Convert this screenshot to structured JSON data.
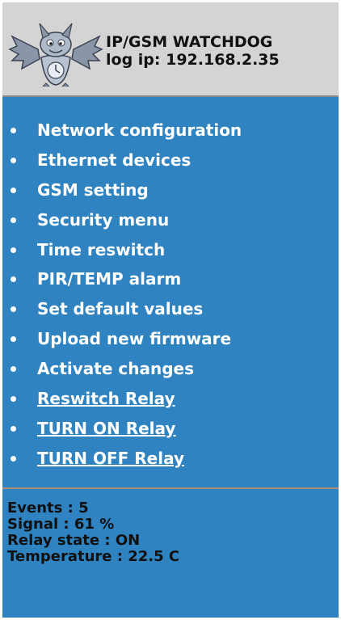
{
  "header": {
    "title": "IP/GSM WATCHDOG",
    "log_ip": "log ip: 192.168.2.35",
    "logo_icon": "bat-dragon-logo-icon"
  },
  "menu": {
    "items": [
      {
        "label": "Network configuration",
        "link": false
      },
      {
        "label": "Ethernet devices",
        "link": false
      },
      {
        "label": "GSM setting",
        "link": false
      },
      {
        "label": "Security menu",
        "link": false
      },
      {
        "label": "Time reswitch",
        "link": false
      },
      {
        "label": "PIR/TEMP alarm",
        "link": false
      },
      {
        "label": "Set default values",
        "link": false
      },
      {
        "label": "Upload new firmware",
        "link": false
      },
      {
        "label": "Activate changes",
        "link": false
      },
      {
        "label": "Reswitch Relay",
        "link": true
      },
      {
        "label": "TURN ON Relay",
        "link": true
      },
      {
        "label": "TURN OFF Relay",
        "link": true
      }
    ]
  },
  "status": {
    "events": "Events : 5",
    "signal": "Signal : 61 %",
    "relay_state": "Relay state : ON",
    "temperature": "Temperature : 22.5 C"
  },
  "colors": {
    "panel_bg": "#2f83c1",
    "header_bg": "#d4d4d4",
    "divider": "#b08f76"
  }
}
